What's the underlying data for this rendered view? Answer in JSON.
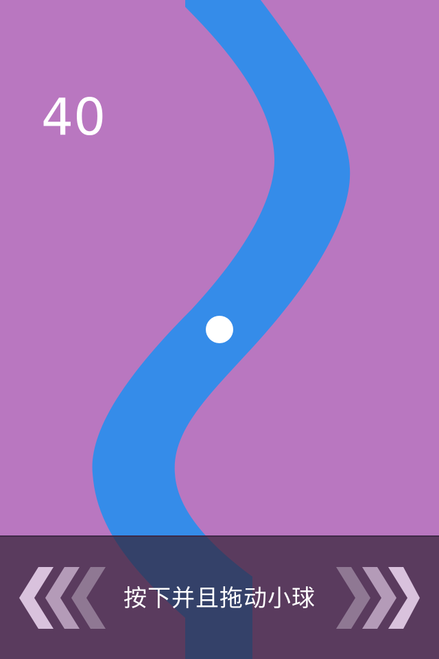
{
  "game": {
    "score": "40",
    "instruction": "按下并且拖动小球"
  },
  "colors": {
    "background": "#b977c0",
    "path": "#358ce9",
    "ball": "#ffffff",
    "bar": "#3e2a44",
    "chevron_light": "#d9c2dd",
    "chevron_mid": "#b49bb8",
    "chevron_dark": "#8f7893"
  },
  "icons": {
    "left": "triple-chevron-left-icon",
    "right": "triple-chevron-right-icon"
  }
}
